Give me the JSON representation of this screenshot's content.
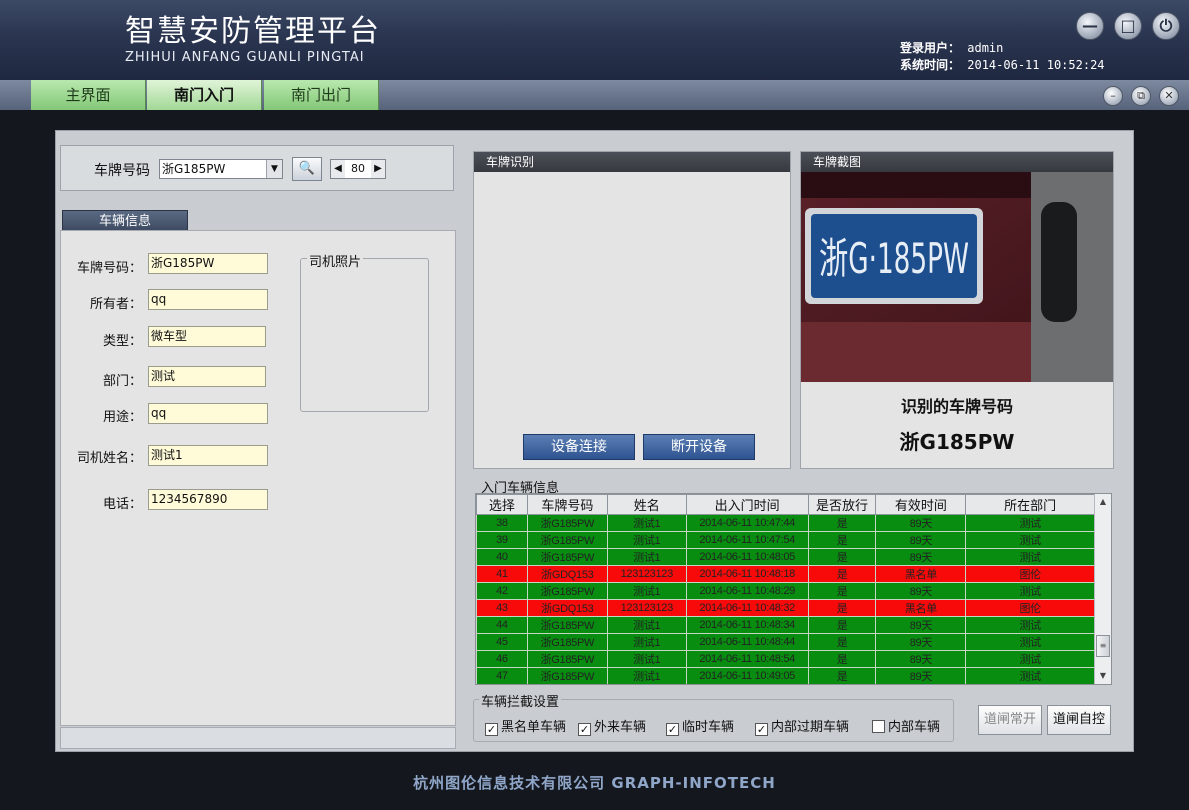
{
  "app": {
    "title_cn": "智慧安防管理平台",
    "title_pinyin": "ZHIHUI ANFANG GUANLI PINGTAI",
    "login_user_label": "登录用户：",
    "login_user": "admin",
    "system_time_label": "系统时间：",
    "system_time": "2014-06-11 10:52:24"
  },
  "window_buttons": {
    "minimize": "—",
    "maximize": "□",
    "power": "⏻"
  },
  "tabs": [
    {
      "label": "主界面",
      "active": false
    },
    {
      "label": "南门入门",
      "active": true
    },
    {
      "label": "南门出门",
      "active": false
    }
  ],
  "sub_buttons": {
    "minimize": "–",
    "popout": "⧉",
    "close": "✕"
  },
  "search": {
    "plate_label": "车牌号码",
    "plate_value": "浙G185PW",
    "search_icon": "🔍",
    "spin_value": "80"
  },
  "vehicle_info": {
    "tab_label": "车辆信息",
    "fields": [
      {
        "label": "车牌号码：",
        "value": "浙G185PW"
      },
      {
        "label": "所有者：",
        "value": "qq"
      },
      {
        "label": "类型：",
        "value": "微车型"
      },
      {
        "label": "部门：",
        "value": "测试"
      },
      {
        "label": "用途：",
        "value": "qq"
      },
      {
        "label": "司机姓名：",
        "value": "测试1"
      },
      {
        "label": "电话：",
        "value": "1234567890"
      }
    ],
    "driver_photo_label": "司机照片"
  },
  "recognition": {
    "header": "车牌识别",
    "connect_button": "设备连接",
    "disconnect_button": "断开设备"
  },
  "capture": {
    "header": "车牌截图",
    "plate_in_image": "浙G·185PW",
    "result_title": "识别的车牌号码",
    "result_plate": "浙G185PW"
  },
  "entry_table": {
    "label": "入门车辆信息",
    "columns": [
      "选择",
      "车牌号码",
      "姓名",
      "出入门时间",
      "是否放行",
      "有效时间",
      "所在部门"
    ],
    "rows": [
      {
        "status": "green",
        "cells": [
          "38",
          "浙G185PW",
          "测试1",
          "2014-06-11 10:47:44",
          "是",
          "89天",
          "测试"
        ]
      },
      {
        "status": "green",
        "cells": [
          "39",
          "浙G185PW",
          "测试1",
          "2014-06-11 10:47:54",
          "是",
          "89天",
          "测试"
        ]
      },
      {
        "status": "green",
        "cells": [
          "40",
          "浙G185PW",
          "测试1",
          "2014-06-11 10:48:05",
          "是",
          "89天",
          "测试"
        ]
      },
      {
        "status": "red",
        "cells": [
          "41",
          "浙GDQ153",
          "123123123",
          "2014-06-11 10:48:18",
          "是",
          "黑名单",
          "图伦"
        ]
      },
      {
        "status": "green",
        "cells": [
          "42",
          "浙G185PW",
          "测试1",
          "2014-06-11 10:48:29",
          "是",
          "89天",
          "测试"
        ]
      },
      {
        "status": "red",
        "cells": [
          "43",
          "浙GDQ153",
          "123123123",
          "2014-06-11 10:48:32",
          "是",
          "黑名单",
          "图伦"
        ]
      },
      {
        "status": "green",
        "cells": [
          "44",
          "浙G185PW",
          "测试1",
          "2014-06-11 10:48:34",
          "是",
          "89天",
          "测试"
        ]
      },
      {
        "status": "green",
        "cells": [
          "45",
          "浙G185PW",
          "测试1",
          "2014-06-11 10:48:44",
          "是",
          "89天",
          "测试"
        ]
      },
      {
        "status": "green",
        "cells": [
          "46",
          "浙G185PW",
          "测试1",
          "2014-06-11 10:48:54",
          "是",
          "89天",
          "测试"
        ]
      },
      {
        "status": "green",
        "cells": [
          "47",
          "浙G185PW",
          "测试1",
          "2014-06-11 10:49:05",
          "是",
          "89天",
          "测试"
        ]
      }
    ]
  },
  "intercept": {
    "label": "车辆拦截设置",
    "options": [
      {
        "label": "黑名单车辆",
        "checked": true
      },
      {
        "label": "外来车辆",
        "checked": true
      },
      {
        "label": "临时车辆",
        "checked": true
      },
      {
        "label": "内部过期车辆",
        "checked": true
      },
      {
        "label": "内部车辆",
        "checked": false
      }
    ],
    "check_mark": "✓"
  },
  "gate": {
    "always_open": "道闸常开",
    "auto_control": "道闸自控"
  },
  "footer": "杭州图伦信息技术有限公司   GRAPH-INFOTECH",
  "colors": {
    "allowed_row": "#088d10",
    "blacklist_row": "#f80a0a",
    "active_tab": "#a3d896"
  }
}
